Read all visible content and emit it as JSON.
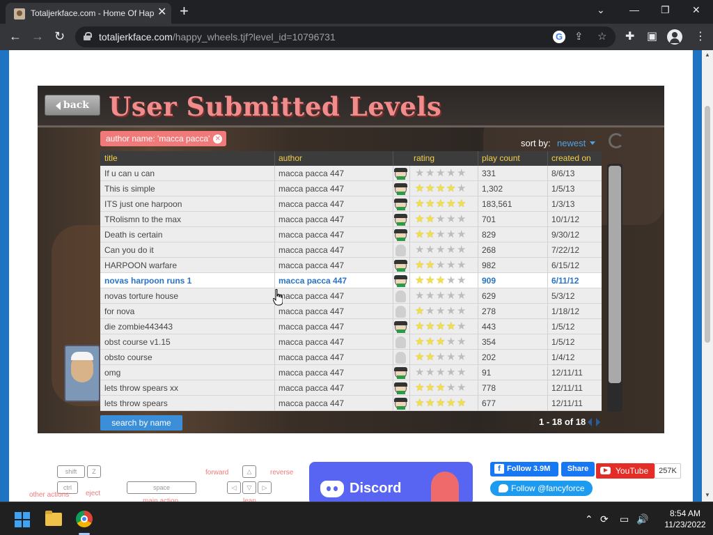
{
  "browser": {
    "tab_title": "Totaljerkface.com - Home Of Happy Wheels",
    "url_host": "totaljerkface.com",
    "url_path": "/happy_wheels.tjf?level_id=10796731"
  },
  "game": {
    "back_label": "back",
    "heading": "User Submitted Levels",
    "filter_tag": "author name: 'macca pacca'",
    "sort_label": "sort by:",
    "sort_value": "newest",
    "columns": [
      "title",
      "author",
      "rating",
      "play count",
      "created on"
    ],
    "rows": [
      {
        "title": "If u can u can",
        "author": "macca pacca 447",
        "user": "face",
        "rating": 0,
        "plays": "331",
        "date": "8/6/13"
      },
      {
        "title": "This is simple",
        "author": "macca pacca 447",
        "user": "face",
        "rating": 3.5,
        "plays": "1,302",
        "date": "1/5/13"
      },
      {
        "title": "ITS just one harpoon",
        "author": "macca pacca 447",
        "user": "face",
        "rating": 4.5,
        "plays": "183,561",
        "date": "1/3/13"
      },
      {
        "title": "TRolismn to the max",
        "author": "macca pacca 447",
        "user": "face",
        "rating": 1.5,
        "plays": "701",
        "date": "10/1/12"
      },
      {
        "title": "Death is certain",
        "author": "macca pacca 447",
        "user": "face",
        "rating": 2,
        "plays": "829",
        "date": "9/30/12"
      },
      {
        "title": "Can you do it",
        "author": "macca pacca 447",
        "user": "ghost",
        "rating": 0,
        "plays": "268",
        "date": "7/22/12"
      },
      {
        "title": " HARPOON warfare",
        "author": "macca pacca 447",
        "user": "face",
        "rating": 1.5,
        "plays": "982",
        "date": "6/15/12"
      },
      {
        "title": "novas harpoon runs 1",
        "author": "macca pacca 447",
        "user": "face",
        "rating": 2.5,
        "plays": "909",
        "date": "6/11/12",
        "selected": true
      },
      {
        "title": "novas torture house",
        "author": "macca pacca 447",
        "user": "ghost",
        "rating": 0,
        "plays": "629",
        "date": "5/3/12"
      },
      {
        "title": "for nova",
        "author": "macca pacca 447",
        "user": "ghost",
        "rating": 0.5,
        "plays": "278",
        "date": "1/18/12"
      },
      {
        "title": "die zombie443443",
        "author": "macca pacca 447",
        "user": "face",
        "rating": 3.5,
        "plays": "443",
        "date": "1/5/12"
      },
      {
        "title": "obst course v1.15",
        "author": "macca pacca 447",
        "user": "ghost",
        "rating": 3,
        "plays": "354",
        "date": "1/5/12"
      },
      {
        "title": "obsto course",
        "author": "macca pacca 447",
        "user": "ghost",
        "rating": 1.5,
        "plays": "202",
        "date": "1/4/12"
      },
      {
        "title": "omg",
        "author": "macca pacca 447",
        "user": "face",
        "rating": 0,
        "plays": "91",
        "date": "12/11/11"
      },
      {
        "title": "lets throw spears xx",
        "author": "macca pacca 447",
        "user": "face",
        "rating": 3,
        "plays": "778",
        "date": "12/11/11"
      },
      {
        "title": "lets throw spears",
        "author": "macca pacca 447",
        "user": "face",
        "rating": 5,
        "plays": "677",
        "date": "12/11/11"
      }
    ],
    "search_button": "search by name",
    "pager_text": "1 - 18 of 18"
  },
  "controls": {
    "shift": "shift",
    "z": "Z",
    "ctrl": "ctrl",
    "space": "space",
    "other_actions": "other actions",
    "eject": "eject",
    "main_action": "main action",
    "forward": "forward",
    "reverse": "reverse",
    "lean": "lean"
  },
  "social": {
    "discord": "Discord",
    "fb_follow": "Follow 3.9M",
    "fb_share": "Share",
    "youtube": "YouTube",
    "youtube_count": "257K",
    "twitter": "Follow @fancyforce"
  },
  "taskbar": {
    "time": "8:54 AM",
    "date": "11/23/2022"
  }
}
